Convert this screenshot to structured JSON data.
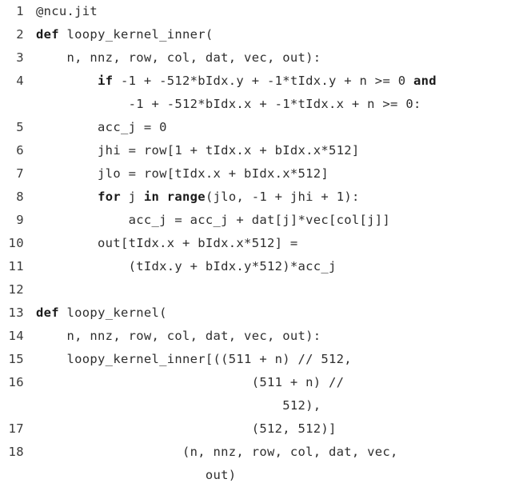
{
  "listing": {
    "language": "python",
    "background_color": "#ffffff",
    "text_color": "#2e2e2e",
    "keyword_color": "#1a1a1a",
    "gutter_color": "#3a3a3a",
    "rows": [
      {
        "number": "1",
        "code": "@ncu.jit"
      },
      {
        "number": "2",
        "code": "def loopy_kernel_inner("
      },
      {
        "number": "3",
        "code": "    n, nnz, row, col, dat, vec, out):"
      },
      {
        "number": "4",
        "code": "        if -1 + -512*bIdx.y + -1*tIdx.y + n >= 0 and"
      },
      {
        "number": "",
        "code": "            -1 + -512*bIdx.x + -1*tIdx.x + n >= 0:"
      },
      {
        "number": "5",
        "code": "        acc_j = 0"
      },
      {
        "number": "6",
        "code": "        jhi = row[1 + tIdx.x + bIdx.x*512]"
      },
      {
        "number": "7",
        "code": "        jlo = row[tIdx.x + bIdx.x*512]"
      },
      {
        "number": "8",
        "code": "        for j in range(jlo, -1 + jhi + 1):"
      },
      {
        "number": "9",
        "code": "            acc_j = acc_j + dat[j]*vec[col[j]]"
      },
      {
        "number": "10",
        "code": "        out[tIdx.x + bIdx.x*512] ="
      },
      {
        "number": "11",
        "code": "            (tIdx.y + bIdx.y*512)*acc_j"
      },
      {
        "number": "12",
        "code": ""
      },
      {
        "number": "13",
        "code": "def loopy_kernel("
      },
      {
        "number": "14",
        "code": "    n, nnz, row, col, dat, vec, out):"
      },
      {
        "number": "15",
        "code": "    loopy_kernel_inner[((511 + n) // 512,"
      },
      {
        "number": "16",
        "code": "                            (511 + n) //"
      },
      {
        "number": "",
        "code": "                                512),"
      },
      {
        "number": "17",
        "code": "                            (512, 512)]"
      },
      {
        "number": "18",
        "code": "                   (n, nnz, row, col, dat, vec,"
      },
      {
        "number": "",
        "code": "                      out)"
      }
    ],
    "keywords": [
      "def",
      "if",
      "and",
      "for",
      "in",
      "range"
    ]
  }
}
